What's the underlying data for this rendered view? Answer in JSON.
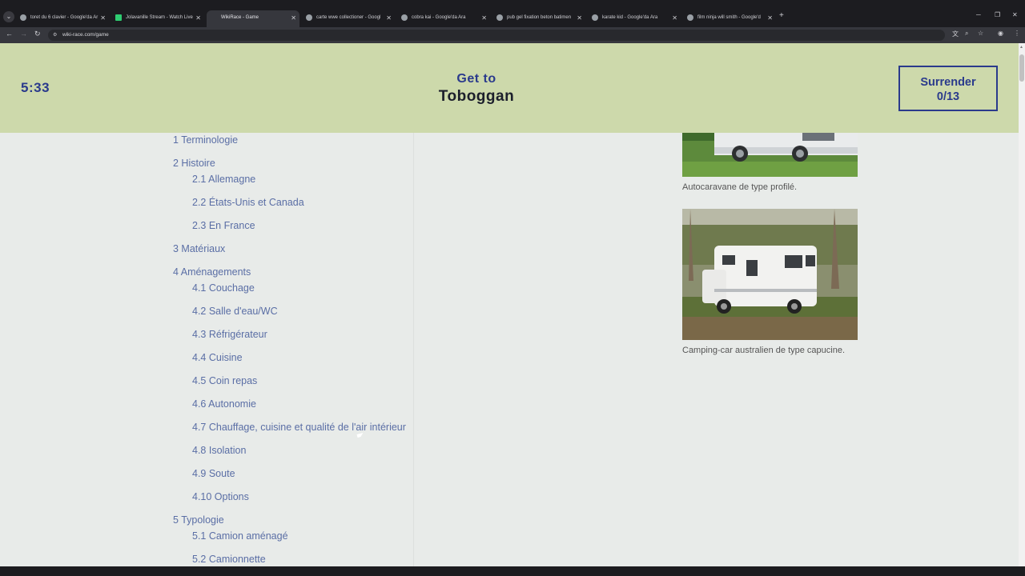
{
  "browser": {
    "tabs": [
      {
        "title": "toret du 6 clavier - Google'da Ar",
        "favicon": "google-icon"
      },
      {
        "title": "Jolavanille Stream - Watch Live",
        "favicon": "kick-icon"
      },
      {
        "title": "WikiRace - Game",
        "favicon": "none",
        "active": true
      },
      {
        "title": "carte wwe collectioner - Googl",
        "favicon": "google-icon"
      },
      {
        "title": "cobra kai - Google'da Ara",
        "favicon": "google-icon"
      },
      {
        "title": "pub gel fixation beton batimen",
        "favicon": "google-icon"
      },
      {
        "title": "karate kid - Google'da Ara",
        "favicon": "google-icon"
      },
      {
        "title": "film ninja will smith - Google'd",
        "favicon": "google-icon"
      }
    ],
    "url": "wiki-race.com/game"
  },
  "game": {
    "timer": "5:33",
    "goal_label": "Get to",
    "goal_target": "Toboggan",
    "surrender_label": "Surrender",
    "progress": "0/13"
  },
  "toc": [
    {
      "label": "1 Terminologie",
      "level": 1
    },
    {
      "label": "2 Histoire",
      "level": 1
    },
    {
      "label": "2.1 Allemagne",
      "level": 2
    },
    {
      "label": "2.2 États-Unis et Canada",
      "level": 2
    },
    {
      "label": "2.3 En France",
      "level": 2
    },
    {
      "label": "3 Matériaux",
      "level": 1
    },
    {
      "label": "4 Aménagements",
      "level": 1
    },
    {
      "label": "4.1 Couchage",
      "level": 2
    },
    {
      "label": "4.2 Salle d'eau/WC",
      "level": 2
    },
    {
      "label": "4.3 Réfrigérateur",
      "level": 2
    },
    {
      "label": "4.4 Cuisine",
      "level": 2
    },
    {
      "label": "4.5 Coin repas",
      "level": 2
    },
    {
      "label": "4.6 Autonomie",
      "level": 2
    },
    {
      "label": "4.7 Chauffage, cuisine et qualité de l'air intérieur",
      "level": 2
    },
    {
      "label": "4.8 Isolation",
      "level": 2
    },
    {
      "label": "4.9 Soute",
      "level": 2
    },
    {
      "label": "4.10 Options",
      "level": 2
    },
    {
      "label": "5 Typologie",
      "level": 1
    },
    {
      "label": "5.1 Camion aménagé",
      "level": 2
    },
    {
      "label": "5.2 Camionnette",
      "level": 2
    }
  ],
  "figures": [
    {
      "caption": "Autocaravane de type profilé."
    },
    {
      "caption": "Camping-car australien de type capucine."
    }
  ],
  "colors": {
    "header_bg": "#cdd9ab",
    "accent": "#2a3a8c",
    "link": "#5a6ea5",
    "page_bg": "#e8ebe9"
  }
}
